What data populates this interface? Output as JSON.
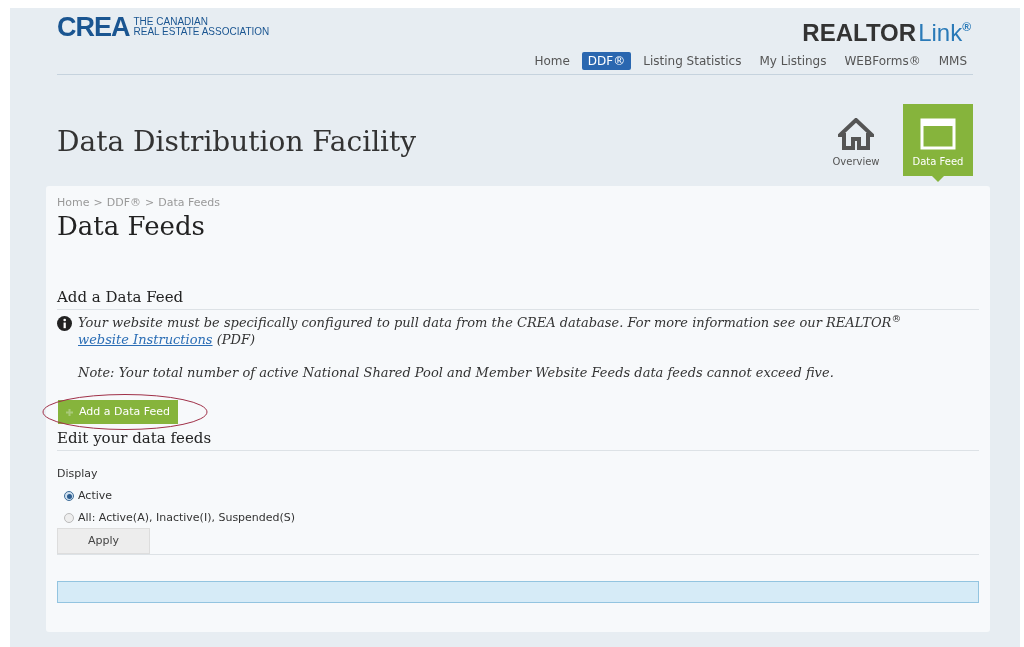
{
  "header": {
    "logo": {
      "mark": "CREA",
      "line_1": "THE CANADIAN",
      "line_2": "REAL ESTATE ASSOCIATION"
    },
    "brand": {
      "part_1": "REALTOR",
      "part_2": "Link",
      "mark": "®"
    },
    "nav": [
      {
        "label": "Home",
        "selected": false
      },
      {
        "label": "DDF®",
        "selected": true
      },
      {
        "label": "Listing Statistics",
        "selected": false
      },
      {
        "label": "My Listings",
        "selected": false
      },
      {
        "label": "WEBForms®",
        "selected": false
      },
      {
        "label": "MMS",
        "selected": false
      }
    ]
  },
  "page_title": "Data Distribution Facility",
  "section_tabs": [
    {
      "kind": "house",
      "label": "Overview",
      "selected": false
    },
    {
      "kind": "window",
      "label": "Data Feed",
      "selected": true
    }
  ],
  "breadcrumb": [
    "Home",
    "DDF®",
    "Data Feeds"
  ],
  "breadcrumb_separator": ">",
  "heading": "Data Feeds",
  "add_section": {
    "title": "Add a Data Feed",
    "info_text": "Your website must be specifically configured to pull data from the CREA database. For more information see our REALTOR$^{®}$",
    "link": "website Instructions",
    "info_after": "(PDF)",
    "note": "Note: Your total number of active National Shared Pool and Member Website Feeds data feeds cannot exceed five.",
    "button": "Add a Data Feed"
  },
  "edit_section": {
    "title": "Edit your data feeds",
    "display_label": "Display",
    "options": [
      {
        "label": "Active",
        "selected": true
      },
      {
        "label": "All: Active(A), Inactive(I), Suspended(S)",
        "selected": false
      }
    ],
    "apply_button": "Apply"
  }
}
